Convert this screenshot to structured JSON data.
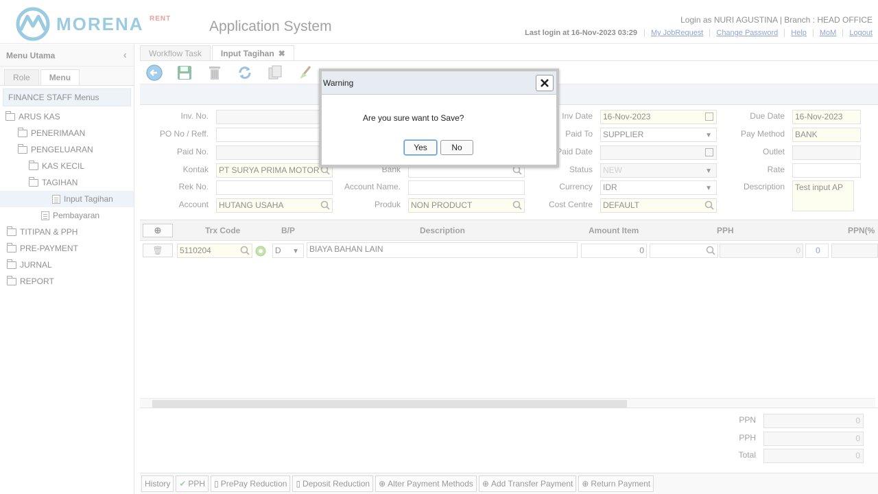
{
  "header": {
    "logo_text": "MORENA",
    "logo_sup": "RENT",
    "app_title": "Application System",
    "login_info": "Login as NURI AGUSTINA | Branch : HEAD OFFICE",
    "last_login": "Last login at 16-Nov-2023 03:29",
    "links": [
      "My JobRequest",
      "Change Password",
      "Help",
      "MoM",
      "Logout"
    ]
  },
  "sidebar": {
    "title": "Menu Utama",
    "tabs": [
      "Role",
      "Menu"
    ],
    "section": "FINANCE STAFF Menus",
    "items": [
      {
        "label": "ARUS KAS",
        "level": 0,
        "type": "folder"
      },
      {
        "label": "PENERIMAAN",
        "level": 1,
        "type": "folder"
      },
      {
        "label": "PENGELUARAN",
        "level": 1,
        "type": "folder"
      },
      {
        "label": "KAS KECIL",
        "level": 2,
        "type": "folder"
      },
      {
        "label": "TAGIHAN",
        "level": 2,
        "type": "folder"
      },
      {
        "label": "Input Tagihan",
        "level": 3,
        "type": "doc",
        "selected": true
      },
      {
        "label": "Pembayaran",
        "level": 2,
        "type": "doc"
      },
      {
        "label": "TITIPAN & PPH",
        "level": 0,
        "type": "folder"
      },
      {
        "label": "PRE-PAYMENT",
        "level": 0,
        "type": "folder"
      },
      {
        "label": "JURNAL",
        "level": 0,
        "type": "folder"
      },
      {
        "label": "REPORT",
        "level": 0,
        "type": "folder"
      }
    ]
  },
  "tabs": [
    {
      "label": "Workflow Task"
    },
    {
      "label": "Input Tagihan",
      "close": "✖"
    }
  ],
  "form": {
    "inv_no_label": "Inv. No.",
    "po_label": "PO No / Reff.",
    "paid_no_label": "Paid No.",
    "kontak_label": "Kontak",
    "kontak_value": "PT SURYA PRIMA MOTOR",
    "rek_label": "Rek No.",
    "account_label": "Account",
    "account_value": "HUTANG USAHA",
    "bank_label": "Bank",
    "account_name_label": "Account Name.",
    "produk_label": "Produk",
    "produk_value": "NON PRODUCT",
    "inv_date_label": "Inv Date",
    "inv_date_value": "16-Nov-2023",
    "paid_to_label": "Paid To",
    "paid_to_value": "SUPPLIER",
    "paid_date_label": "Paid Date",
    "status_label": "Status",
    "status_value": "NEW",
    "currency_label": "Currency",
    "currency_value": "IDR",
    "cost_centre_label": "Cost Centre",
    "cost_centre_value": "DEFAULT",
    "due_date_label": "Due Date",
    "due_date_value": "16-Nov-2023",
    "pay_method_label": "Pay Method",
    "pay_method_value": "BANK",
    "outlet_label": "Outlet",
    "rate_label": "Rate",
    "description_label": "Description",
    "description_value": "Test input AP"
  },
  "grid": {
    "headers": [
      "Trx Code",
      "B/P",
      "Description",
      "Amount Item",
      "PPH",
      "PPN(%"
    ],
    "row": {
      "trx_code": "5110204",
      "bp": "D",
      "description": "BIAYA BAHAN LAIN",
      "amount": "0",
      "pph_amount": "0",
      "ppn": "0"
    }
  },
  "totals": {
    "ppn_label": "PPN",
    "ppn_value": "0",
    "pph_label": "PPH",
    "pph_value": "0",
    "total_label": "Total",
    "total_value": "0"
  },
  "bottom_buttons": [
    "History",
    "PPH",
    "PrePay Reduction",
    "Deposit Reduction",
    "Alter Payment Methods",
    "Add Transfer Payment",
    "Return Payment"
  ],
  "dialog": {
    "title": "Warning",
    "message": "Are you sure want to Save?",
    "yes": "Yes",
    "no": "No"
  }
}
